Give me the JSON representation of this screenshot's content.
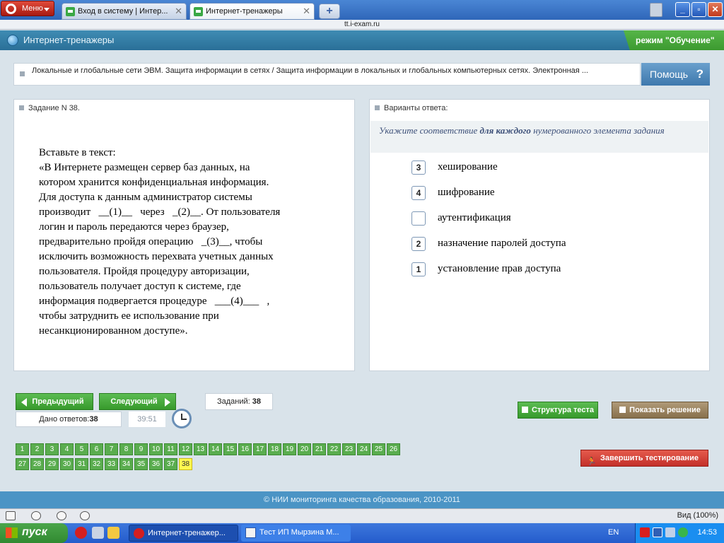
{
  "browser": {
    "menu_label": "Меню",
    "tabs": [
      {
        "label": "Вход в систему | Интер..."
      },
      {
        "label": "Интернет-тренажеры"
      }
    ],
    "url": "tt.i-exam.ru"
  },
  "header": {
    "site_name": "Интернет-тренажеры",
    "mode": "режим \"Обучение\""
  },
  "breadcrumb": {
    "text": "Локальные и глобальные сети ЭВМ. Защита информации в сетях / Защита информации в локальных и глобальных компьютерных сетях. Электронная ..."
  },
  "help": {
    "label": "Помощь",
    "icon": "?"
  },
  "task": {
    "title": "Задание N 38.",
    "lines": [
      "Вставьте в текст:",
      "«В Интернете размещен сервер баз данных, на",
      "котором хранится конфиденциальная информация.",
      "Для доступа к данным администратор системы",
      "производит   __(1)__   через   _(2)__. От пользователя",
      "логин и пароль передаются через браузер,",
      "предварительно пройдя операцию   _(3)__, чтобы",
      "исключить возможность перехвата учетных данных",
      "пользователя. Пройдя процедуру авторизации,",
      "пользователь получает доступ к системе, где",
      "информация подвергается процедуре   ___(4)___   ,",
      "чтобы затруднить ее использование при",
      "несанкционированном доступе»."
    ]
  },
  "answers": {
    "title": "Варианты ответа:",
    "hint_pre": "Укажите соответствие ",
    "hint_bold": "для каждого",
    "hint_post": " нумерованного элемента задания",
    "options": [
      {
        "value": "3",
        "label": "хеширование"
      },
      {
        "value": "4",
        "label": "шифрование"
      },
      {
        "value": "",
        "label": "аутентификация"
      },
      {
        "value": "2",
        "label": "назначение паролей доступа"
      },
      {
        "value": "1",
        "label": "установление прав доступа"
      }
    ]
  },
  "nav": {
    "prev_label": "Предыдущий",
    "next_label": "Следующий",
    "tasks_label": "Заданий:",
    "tasks_count": "38",
    "answered_label": "Дано ответов:",
    "answered_count": "38",
    "timer": "39:51",
    "structure_label": "Структура теста",
    "solution_label": "Показать решение",
    "finish_label": "Завершить тестирование",
    "questions": [
      "1",
      "2",
      "3",
      "4",
      "5",
      "6",
      "7",
      "8",
      "9",
      "10",
      "11",
      "12",
      "13",
      "14",
      "15",
      "16",
      "17",
      "18",
      "19",
      "20",
      "21",
      "22",
      "23",
      "24",
      "25",
      "26",
      "27",
      "28",
      "29",
      "30",
      "31",
      "32",
      "33",
      "34",
      "35",
      "36",
      "37",
      "38"
    ],
    "current_question": "38"
  },
  "footer": {
    "copyright": "© НИИ мониторинга качества образования, 2010-2011"
  },
  "statusbar": {
    "zoom": "Вид (100%)"
  },
  "taskbar": {
    "start_label": "пуск",
    "items": [
      {
        "label": "Интернет-тренажер..."
      },
      {
        "label": "Тест ИП Мырзина М..."
      }
    ],
    "lang": "EN",
    "time": "14:53"
  },
  "colors": {
    "green_button": "#4caf44",
    "header_blue": "#3a84ad",
    "finish_red": "#d4443a",
    "current_question": "#fff84f"
  }
}
